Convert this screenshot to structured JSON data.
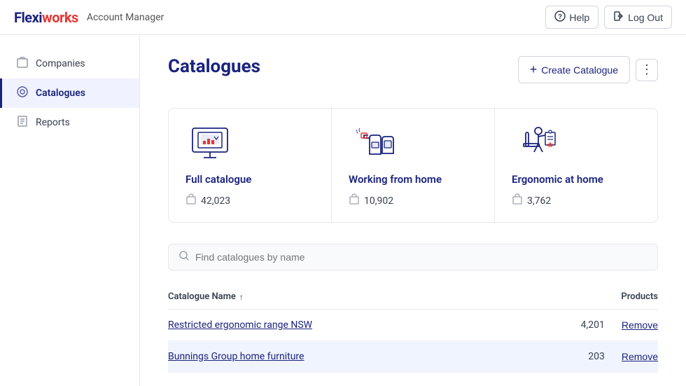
{
  "app": {
    "logo": "Flexiworks",
    "logo_accent": "works",
    "subtitle": "Account Manager"
  },
  "header": {
    "help_label": "Help",
    "logout_label": "Log Out"
  },
  "sidebar": {
    "items": [
      {
        "id": "companies",
        "label": "Companies",
        "icon": "🏢",
        "active": false
      },
      {
        "id": "catalogues",
        "label": "Catalogues",
        "icon": "🏷",
        "active": true
      },
      {
        "id": "reports",
        "label": "Reports",
        "icon": "📋",
        "active": false
      }
    ]
  },
  "main": {
    "page_title": "Catalogues",
    "create_button_label": "Create Catalogue",
    "catalogue_cards": [
      {
        "name": "Full catalogue",
        "count": "42,023",
        "illustration": "monitor"
      },
      {
        "name": "Working from home",
        "count": "10,902",
        "illustration": "spray"
      },
      {
        "name": "Ergonomic at home",
        "count": "3,762",
        "illustration": "chair"
      }
    ],
    "search_placeholder": "Find catalogues by name",
    "table": {
      "col_name": "Catalogue Name",
      "col_products": "Products",
      "rows": [
        {
          "name": "Restricted ergonomic range NSW",
          "count": "4,201"
        },
        {
          "name": "Bunnings Group home furniture",
          "count": "203"
        }
      ]
    }
  }
}
